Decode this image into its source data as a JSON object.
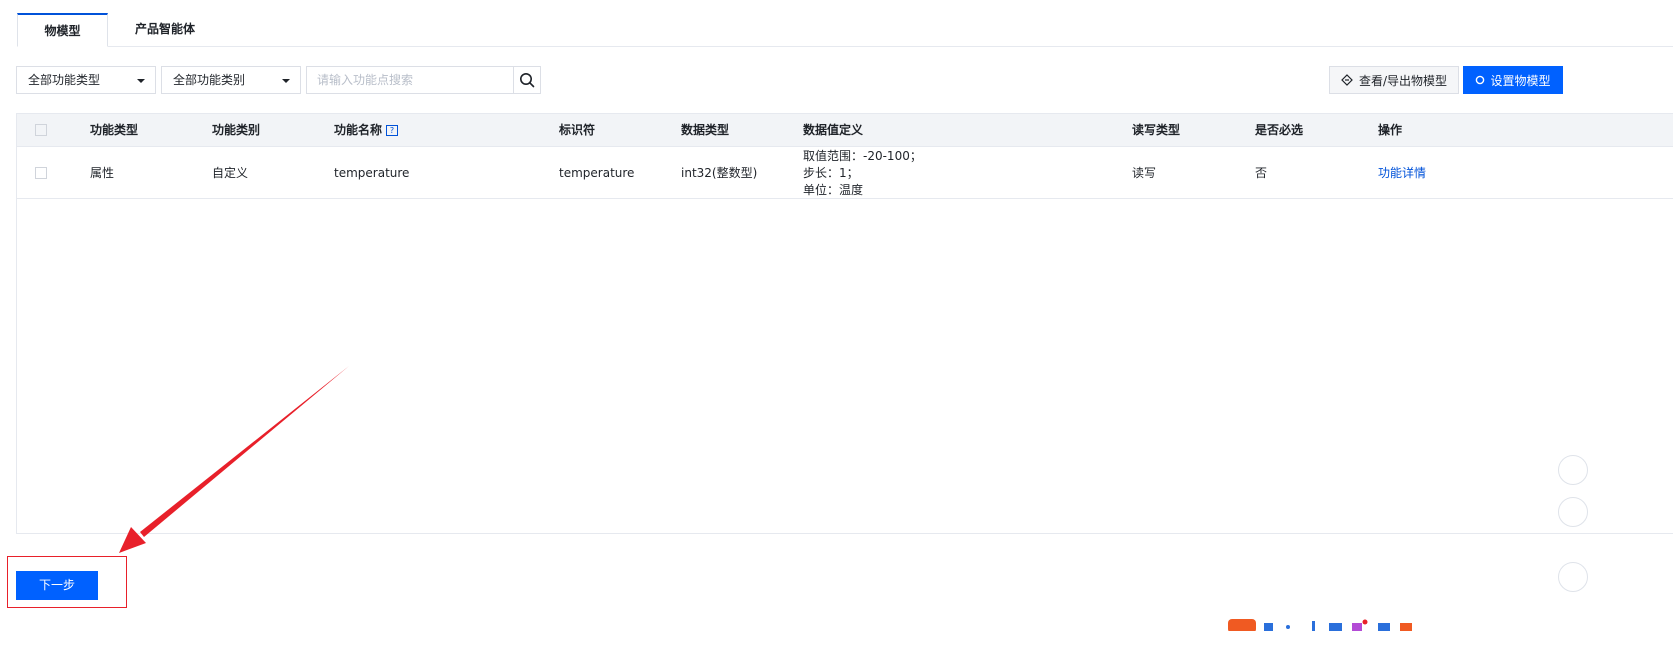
{
  "tabs": [
    {
      "label": "物模型",
      "active": true
    },
    {
      "label": "产品智能体",
      "active": false
    }
  ],
  "toolbar": {
    "type_filter": "全部功能类型",
    "category_filter": "全部功能类别",
    "search_placeholder": "请输入功能点搜索",
    "export_label": "查看/导出物模型",
    "setup_label": "设置物模型"
  },
  "table": {
    "headers": {
      "type": "功能类型",
      "category": "功能类别",
      "name": "功能名称",
      "identifier": "标识符",
      "data_type": "数据类型",
      "definition": "数据值定义",
      "access": "读写类型",
      "required": "是否必选",
      "action": "操作"
    },
    "rows": [
      {
        "type": "属性",
        "category": "自定义",
        "name": "temperature",
        "identifier": "temperature",
        "data_type": "int32(整数型)",
        "definition": [
          "取值范围：-20-100；",
          "步长：1；",
          "单位：温度"
        ],
        "access": "读写",
        "required": "否",
        "action": "功能详情"
      }
    ]
  },
  "footer": {
    "next_label": "下一步"
  },
  "colors": {
    "primary": "#0061ff",
    "link": "#0052d9",
    "annotation": "#e8202a",
    "header_bg": "#f2f4f7"
  }
}
